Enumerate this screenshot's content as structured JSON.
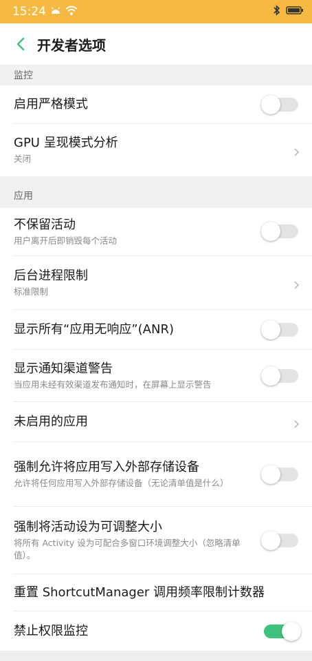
{
  "status_bar": {
    "time": "15:24",
    "icons": [
      "android-notification-icon",
      "wifi-icon",
      "bluetooth-icon",
      "battery-icon"
    ]
  },
  "app_bar": {
    "title": "开发者选项",
    "back_icon": "chevron-left-icon"
  },
  "sections": {
    "monitoring": {
      "label": "监控"
    },
    "apps": {
      "label": "应用"
    }
  },
  "rows": {
    "strict_mode": {
      "title": "启用严格模式",
      "toggle": false
    },
    "gpu_profiling": {
      "title": "GPU 呈现模式分析",
      "subtitle": "关闭"
    },
    "dont_keep_activities": {
      "title": "不保留活动",
      "subtitle": "用户离开后即销毁每个活动",
      "toggle": false
    },
    "background_limit": {
      "title": "后台进程限制",
      "subtitle": "标准限制"
    },
    "show_all_anr": {
      "title": "显示所有“应用无响应”(ANR)",
      "toggle": false
    },
    "channel_warnings": {
      "title": "显示通知渠道警告",
      "subtitle": "当应用未经有效渠道发布通知时，在屏幕上显示警告",
      "toggle": false
    },
    "inactive_apps": {
      "title": "未启用的应用"
    },
    "force_external": {
      "title": "强制允许将应用写入外部存储设备",
      "subtitle": "允许将任何应用写入外部存储设备（无论清单值是什么）",
      "toggle": false
    },
    "force_resizable": {
      "title": "强制将活动设为可调整大小",
      "subtitle": "将所有 Activity 设为可配合多窗口环境调整大小（忽略清单值）。",
      "toggle": false
    },
    "reset_shortcut": {
      "title": "重置 ShortcutManager 调用频率限制计数器"
    },
    "disable_permission_monitoring": {
      "title": "禁止权限监控",
      "toggle": true
    }
  },
  "colors": {
    "status_bar": "#f5b942",
    "accent_green": "#3ec27d",
    "section_bg": "#f1f1f1"
  }
}
